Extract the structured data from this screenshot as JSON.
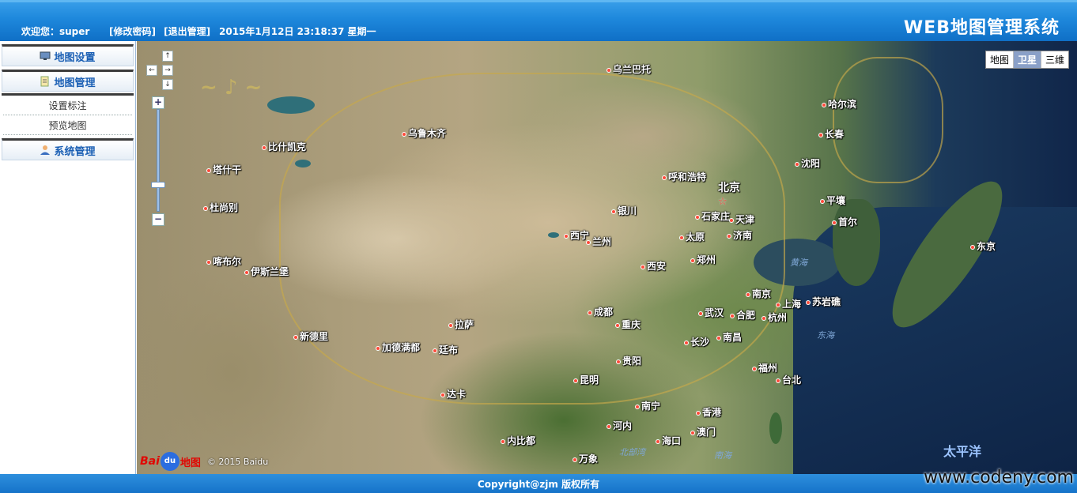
{
  "header": {
    "welcome": "欢迎您：super",
    "change_password": "[修改密码]",
    "logout": "[退出管理]",
    "datetime": "2015年1月12日 23:18:37 星期一",
    "title": "WEB地图管理系统"
  },
  "sidebar": {
    "menu_map_settings": "地图设置",
    "menu_map_management": "地图管理",
    "sub_items": [
      "设置标注",
      "预览地图"
    ],
    "menu_system_management": "系统管理"
  },
  "map": {
    "type_buttons": [
      "地图",
      "卫星",
      "三维"
    ],
    "active_type": "卫星",
    "zoom_in": "+",
    "zoom_out": "−",
    "nav_up": "↑",
    "nav_left": "←",
    "nav_right": "→",
    "nav_down": "↓",
    "logo_bai": "Bai",
    "logo_du": "du",
    "logo_ditu": "地图",
    "copyright": "© 2015 Baidu",
    "cities": [
      "乌兰巴托",
      "哈尔滨",
      "长春",
      "沈阳",
      "乌鲁木齐",
      "比什凯克",
      "塔什干",
      "呼和浩特",
      "北京",
      "平壤",
      "首尔",
      "杜尚别",
      "银川",
      "石家庄",
      "天津",
      "太原",
      "济南",
      "西宁",
      "兰州",
      "东京",
      "喀布尔",
      "伊斯兰堡",
      "西安",
      "郑州",
      "南京",
      "上海",
      "苏岩礁",
      "成都",
      "武汉",
      "合肥",
      "杭州",
      "重庆",
      "拉萨",
      "新德里",
      "加德满都",
      "廷布",
      "长沙",
      "南昌",
      "贵阳",
      "福州",
      "台北",
      "昆明",
      "达卡",
      "南宁",
      "香港",
      "澳门",
      "河内",
      "内比都",
      "海口",
      "万象"
    ],
    "seas": [
      "黄海",
      "东海",
      "南海",
      "北部湾"
    ],
    "ocean": "太平洋"
  },
  "footer": {
    "copyright": "Copyright@zjm 版权所有"
  },
  "site_mark": "www.codeny.com",
  "colors": {
    "header_blue": "#1e88dc",
    "menu_text": "#1a5fb4",
    "city_dot": "#ff4a3a"
  }
}
